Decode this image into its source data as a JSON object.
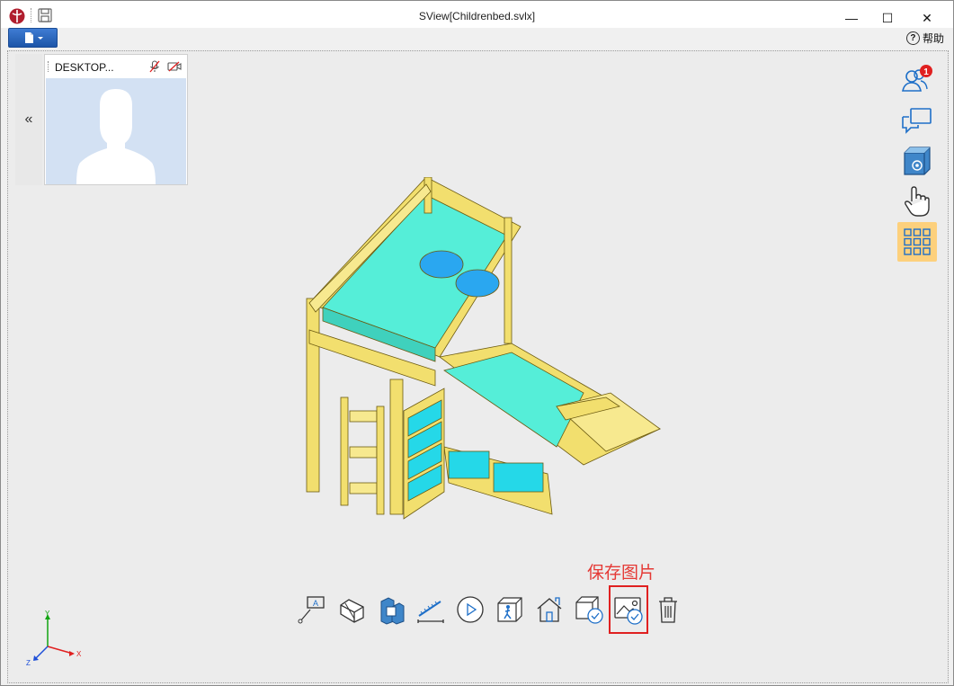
{
  "window": {
    "title": "SView[Childrenbed.svlx]",
    "minimize_glyph": "—",
    "maximize_glyph": "☐",
    "close_glyph": "✕",
    "help_label": "帮助",
    "help_glyph": "?"
  },
  "participant": {
    "name": "DESKTOP...",
    "collapse_glyph": "«"
  },
  "annotation": {
    "callout_text": "保存图片"
  },
  "axes": {
    "x": "X",
    "y": "Y",
    "z": "Z"
  },
  "side_toolbar": {
    "participants_badge": "1"
  },
  "colors": {
    "accent": "#1d6fd8",
    "highlight": "#e02020",
    "active_button": "#fdd07c",
    "bed_frame": "#f2df6e",
    "mattress": "#55eed8",
    "pillow": "#2aa7f0",
    "drawer": "#25d8e8"
  }
}
